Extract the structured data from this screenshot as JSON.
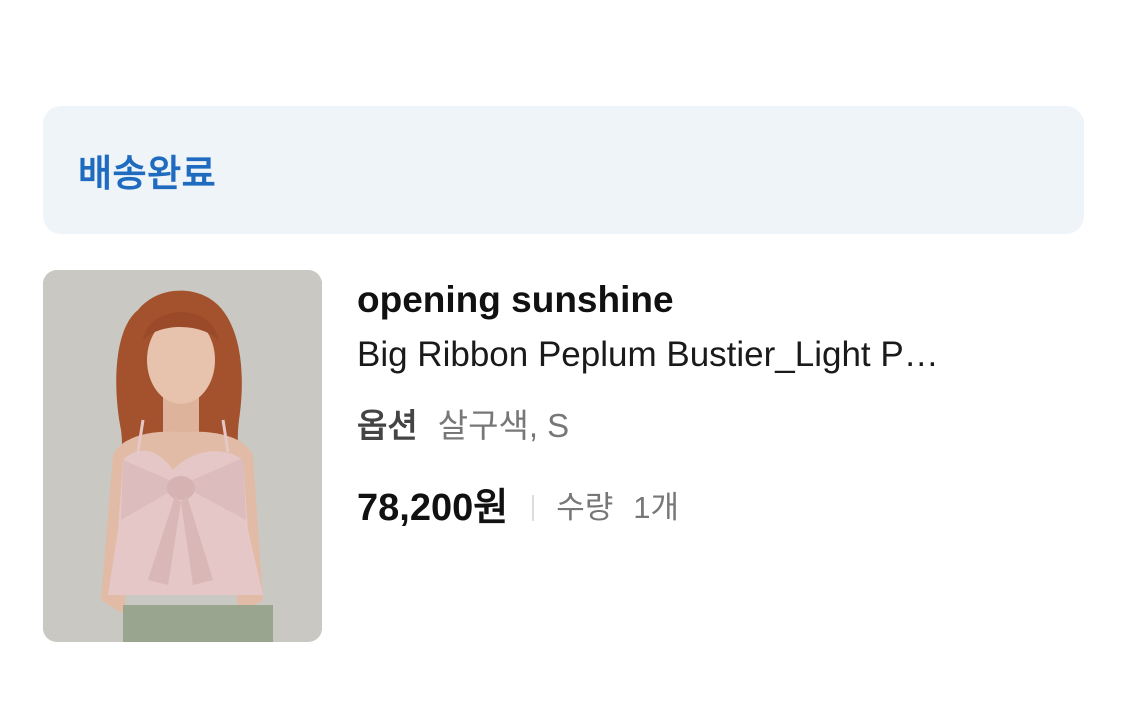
{
  "order": {
    "status": "배송완료"
  },
  "product": {
    "brand": "opening sunshine",
    "name": "Big Ribbon Peplum Bustier_Light P…",
    "option_label": "옵션",
    "option_value": "살구색, S",
    "price": "78,200원",
    "quantity_label": "수량",
    "quantity_value": "1개"
  },
  "image": {
    "icon": "product-photo",
    "colors": {
      "background": "#c9c8c3",
      "hair": "#a4512d",
      "skin": "#e7c3ad",
      "top": "#e4c7c6",
      "pants": "#9aa58f"
    }
  },
  "colors": {
    "accent": "#1f6bc0",
    "banner_bg": "#eff4f9"
  }
}
